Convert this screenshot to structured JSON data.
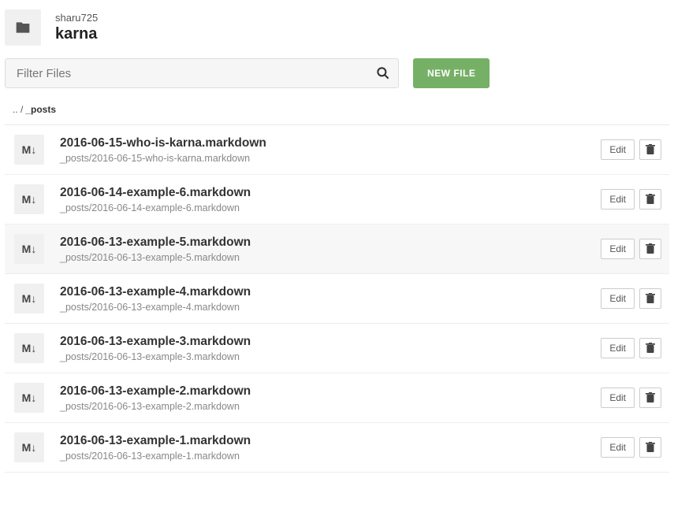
{
  "header": {
    "owner": "sharu725",
    "repo": "karna"
  },
  "toolbar": {
    "filter_placeholder": "Filter Files",
    "new_file_label": "NEW FILE"
  },
  "breadcrumb": {
    "parent": ".. /",
    "current": "_posts"
  },
  "actions": {
    "edit_label": "Edit"
  },
  "icons": {
    "markdown": "M↓"
  },
  "files": [
    {
      "title": "2016-06-15-who-is-karna.markdown",
      "path": "_posts/2016-06-15-who-is-karna.markdown",
      "hover": false
    },
    {
      "title": "2016-06-14-example-6.markdown",
      "path": "_posts/2016-06-14-example-6.markdown",
      "hover": false
    },
    {
      "title": "2016-06-13-example-5.markdown",
      "path": "_posts/2016-06-13-example-5.markdown",
      "hover": true
    },
    {
      "title": "2016-06-13-example-4.markdown",
      "path": "_posts/2016-06-13-example-4.markdown",
      "hover": false
    },
    {
      "title": "2016-06-13-example-3.markdown",
      "path": "_posts/2016-06-13-example-3.markdown",
      "hover": false
    },
    {
      "title": "2016-06-13-example-2.markdown",
      "path": "_posts/2016-06-13-example-2.markdown",
      "hover": false
    },
    {
      "title": "2016-06-13-example-1.markdown",
      "path": "_posts/2016-06-13-example-1.markdown",
      "hover": false
    }
  ]
}
